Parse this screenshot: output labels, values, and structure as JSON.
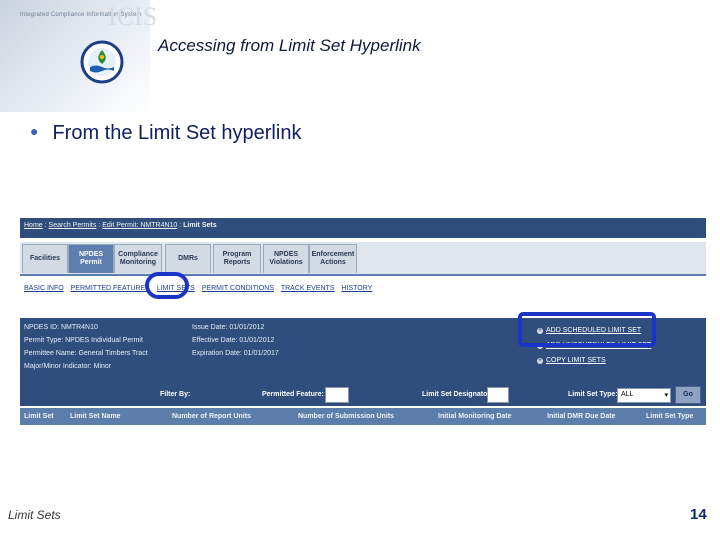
{
  "header": {
    "system_text": "Integrated Compliance Information System",
    "icis_text": "ICIS",
    "title": "Accessing from Limit Set Hyperlink"
  },
  "bullet": "From the Limit Set hyperlink",
  "screenshot": {
    "breadcrumb": [
      "Home",
      "Search Permits",
      "Edit Permit: NMTR4N10",
      "Limit Sets"
    ],
    "tabs": [
      {
        "label": "Facilities",
        "active": false
      },
      {
        "label": "NPDES Permit",
        "active": true
      },
      {
        "label": "Compliance Monitoring",
        "active": false
      },
      {
        "label": "DMRs",
        "active": false
      },
      {
        "label": "Program Reports",
        "active": false
      },
      {
        "label": "NPDES Violations",
        "active": false
      },
      {
        "label": "Enforcement Actions",
        "active": false
      }
    ],
    "subnav": [
      "BASIC INFO",
      "PERMITTED FEATURES",
      "LIMIT SETS",
      "PERMIT CONDITIONS",
      "TRACK EVENTS",
      "HISTORY"
    ],
    "info": {
      "npdes_id": "NPDES ID: NMTR4N10",
      "permit_type": "Permit Type: NPDES Individual Permit",
      "permittee": "Permittee Name: General Timbers Tract",
      "major_minor": "Major/Minor Indicator: Minor",
      "issue_date": "Issue Date: 01/01/2012",
      "effective_date": "Effective Date: 01/01/2012",
      "expiration_date": "Expiration Date: 01/01/2017"
    },
    "action_links": [
      "ADD SCHEDULED LIMIT SET",
      "ADD UNSCHEDULED LIMIT SET",
      "COPY LIMIT SETS"
    ],
    "filter": {
      "filter_by": "Filter By:",
      "permitted_feature": "Permitted Feature:",
      "limit_set_designator": "Limit Set Designator:",
      "limit_set_type": "Limit Set Type:",
      "limit_set_type_value": "ALL",
      "go": "Go"
    },
    "columns": [
      "Limit Set",
      "Limit Set Name",
      "Number of Report Units",
      "Number of Submission Units",
      "Initial Monitoring Date",
      "Initial DMR Due Date",
      "Limit Set Type"
    ]
  },
  "footer": {
    "left": "Limit Sets",
    "page_number": "14"
  },
  "colors": {
    "title_text": "#0c1a3c",
    "bullet_text": "#102060",
    "panel_blue": "#2f4e7d",
    "highlight": "#1a34c8"
  }
}
